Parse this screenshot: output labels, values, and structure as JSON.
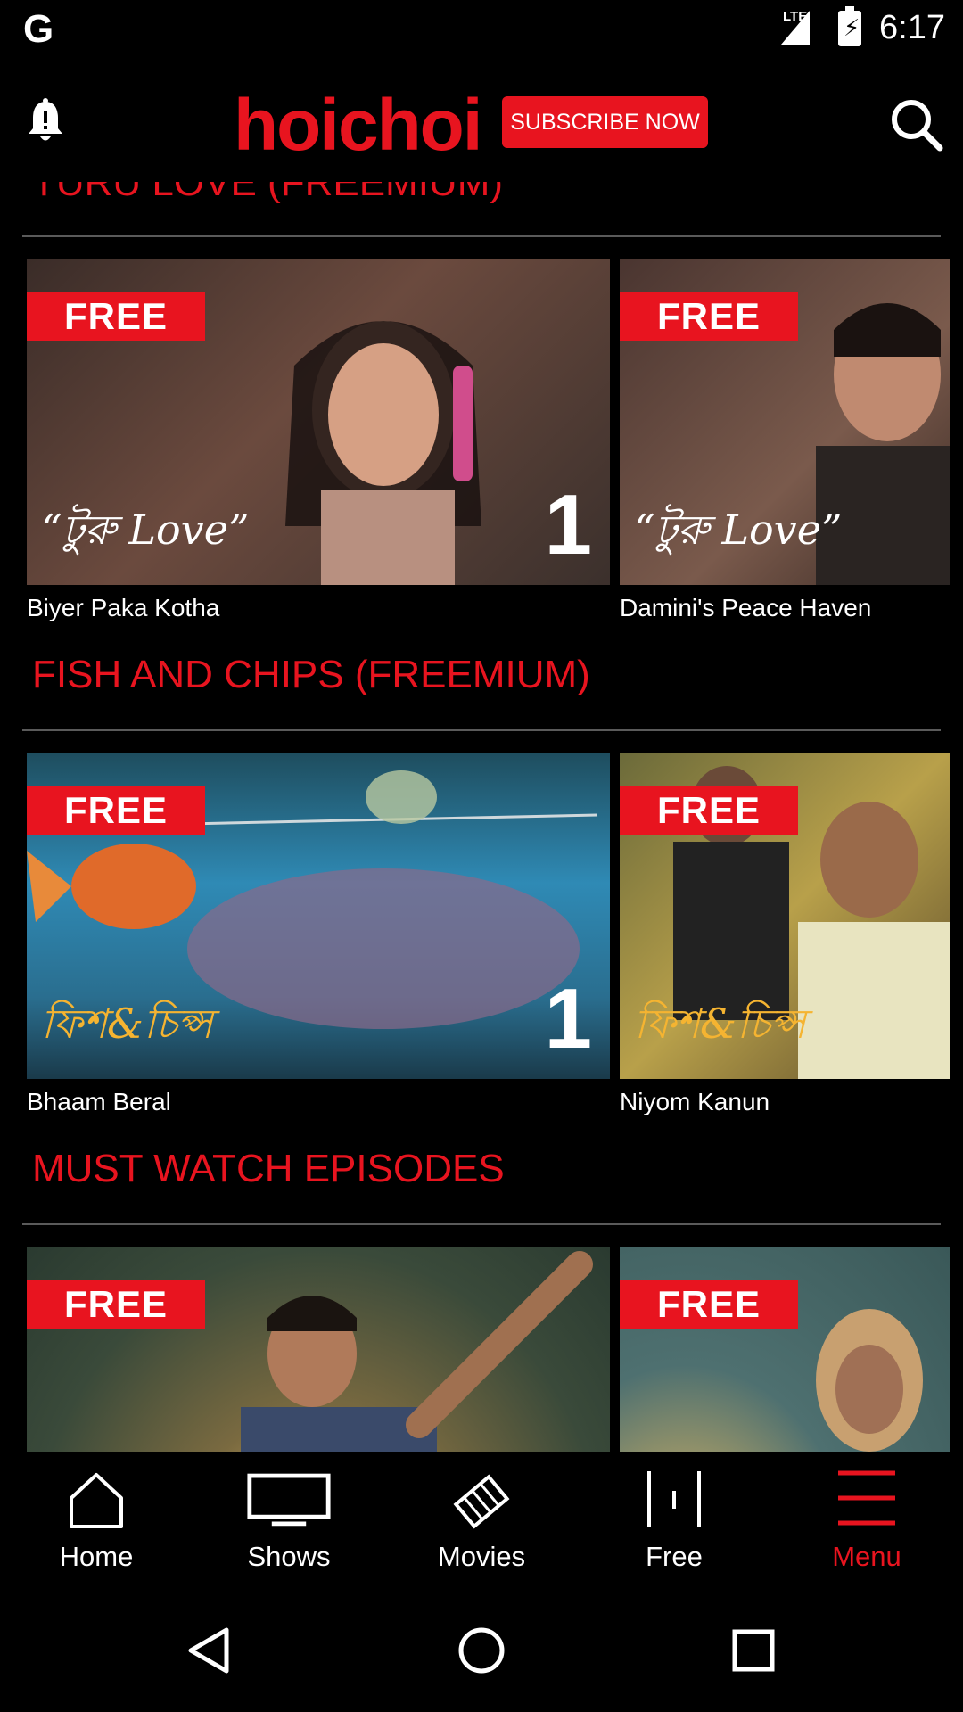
{
  "status_bar": {
    "network": "LTE",
    "time": "6:17"
  },
  "header": {
    "logo": "hoichoi",
    "subscribe_label": "SUBSCRIBE NOW"
  },
  "sections": [
    {
      "title": "TURU LOVE (FREEMIUM)",
      "items": [
        {
          "badge": "FREE",
          "title": "Biyer Paka Kotha",
          "episode": "1",
          "logo_text": "“টুরু Love”",
          "bg": "#4a3a33"
        },
        {
          "badge": "FREE",
          "title": "Damini's Peace Haven",
          "episode": "",
          "logo_text": "“টুরু Love”",
          "bg": "#5a4238"
        }
      ]
    },
    {
      "title": "FISH AND CHIPS (FREEMIUM)",
      "items": [
        {
          "badge": "FREE",
          "title": "Bhaam Beral",
          "episode": "1",
          "logo_text": "ফিশ&চিপ্স",
          "bg": "#2a6e8f"
        },
        {
          "badge": "FREE",
          "title": "Niyom Kanun",
          "episode": "",
          "logo_text": "ফিশ&চিপ্স",
          "bg": "#8a7a35"
        }
      ]
    },
    {
      "title": "MUST WATCH EPISODES",
      "items": [
        {
          "badge": "FREE",
          "title": "",
          "episode": "",
          "logo_text": "",
          "bg": "#4a5a3a"
        },
        {
          "badge": "FREE",
          "title": "",
          "episode": "",
          "logo_text": "",
          "bg": "#4e7070"
        }
      ]
    }
  ],
  "bottom_nav": [
    {
      "label": "Home",
      "icon": "home-icon",
      "active": false
    },
    {
      "label": "Shows",
      "icon": "tv-icon",
      "active": false
    },
    {
      "label": "Movies",
      "icon": "film-icon",
      "active": false
    },
    {
      "label": "Free",
      "icon": "free-icon",
      "active": false
    },
    {
      "label": "Menu",
      "icon": "menu-icon",
      "active": true
    }
  ],
  "colors": {
    "accent": "#e8141f",
    "background": "#000000",
    "divider": "#5a5a5a"
  }
}
